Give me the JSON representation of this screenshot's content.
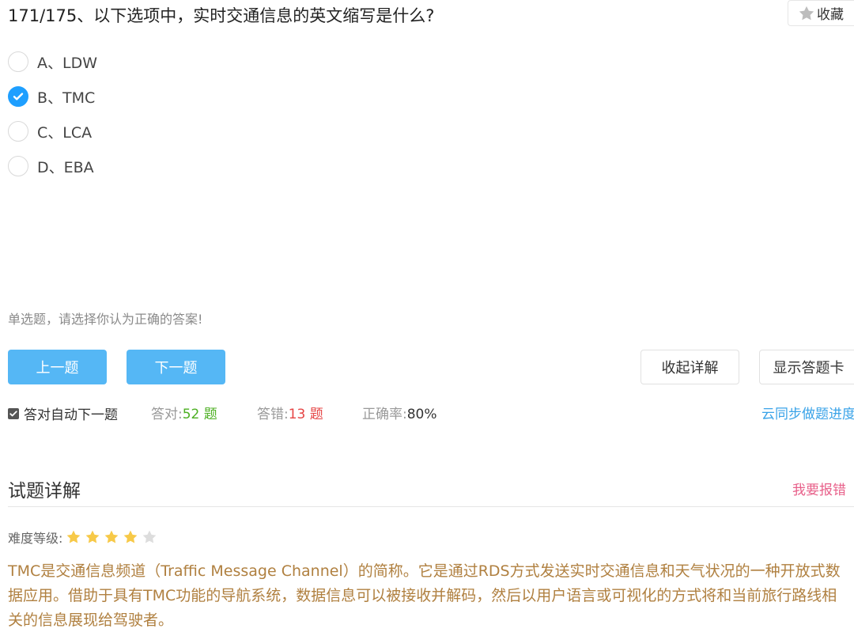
{
  "question": {
    "title": "171/175、以下选项中，实时交通信息的英文缩写是什么?"
  },
  "favorite": {
    "label": "收藏",
    "icon": "star-icon"
  },
  "options": [
    {
      "label": "A、LDW",
      "selected": false
    },
    {
      "label": "B、TMC",
      "selected": true
    },
    {
      "label": "C、LCA",
      "selected": false
    },
    {
      "label": "D、EBA",
      "selected": false
    }
  ],
  "hint": "单选题，请选择你认为正确的答案!",
  "buttons": {
    "prev": "上一题",
    "next": "下一题",
    "collapse_detail": "收起详解",
    "show_answer_card": "显示答题卡"
  },
  "stats": {
    "auto_next_label": "答对自动下一题",
    "auto_next_checked": true,
    "correct_label": "答对:",
    "correct_count": "52",
    "correct_unit": "题",
    "wrong_label": "答错:",
    "wrong_count": "13",
    "wrong_unit": "题",
    "accuracy_label": "正确率:",
    "accuracy_value": "80%",
    "sync_link": "云同步做题进度"
  },
  "detail": {
    "heading": "试题详解",
    "report_link": "我要报错",
    "difficulty_label": "难度等级:",
    "difficulty_stars": 4,
    "difficulty_max": 5,
    "explanation": "TMC是交通信息频道（Traffic Message Channel）的简称。它是通过RDS方式发送实时交通信息和天气状况的一种开放式数据应用。借助于具有TMC功能的导航系统，数据信息可以被接收并解码，然后以用户语言或可视化的方式将和当前旅行路线相关的信息展现给驾驶者。"
  },
  "colors": {
    "primary_button": "#55b7f5",
    "radio_checked": "#1e9fff",
    "correct_count": "#4caf22",
    "wrong_count": "#e64545",
    "sync_link": "#3aa3e8",
    "report_link": "#e8608a",
    "explanation_text": "#b08040",
    "star_filled": "#f7c948",
    "star_empty": "#dddddd"
  }
}
